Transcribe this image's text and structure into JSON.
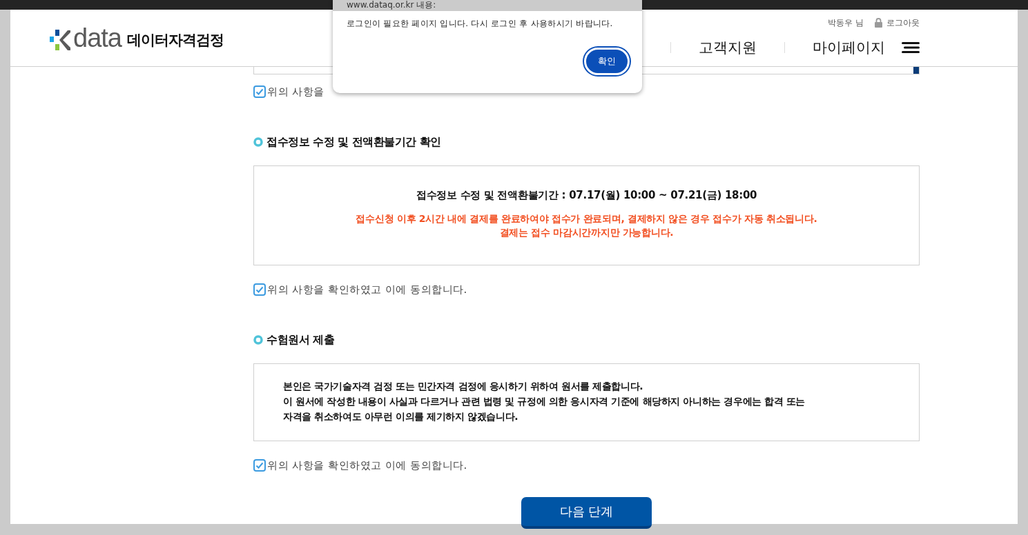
{
  "dialog": {
    "title": "www.dataq.or.kr 내용:",
    "message": "로그인이 필요한 페이지 입니다. 다시 로그인 후 사용하시기 바랍니다.",
    "button": "확인"
  },
  "header": {
    "logo_wordmark": "data",
    "logo_text": "데이터자격검정",
    "user": "박동우 님",
    "logout": "로그아웃",
    "nav": [
      "고객지원",
      "마이페이지"
    ]
  },
  "top_agreement": {
    "label": "위의 사항을",
    "checked": true
  },
  "sections": [
    {
      "kind": "notice",
      "title": "접수정보 수정 및 전액환불기간 확인",
      "heading": "접수정보 수정 및 전액환불기간 : 07.17(월) 10:00 ~ 07.21(금) 18:00",
      "lines": [
        "접수신청 이후 2시간 내에 결제를 완료하여야 접수가 완료되며, 결제하지 않은 경우 접수가 자동 취소됩니다.",
        "결제는 접수 마감시간까지만 가능합니다."
      ],
      "agreement": {
        "label": "위의 사항을 확인하였고 이에 동의합니다.",
        "checked": true
      }
    },
    {
      "kind": "pledge",
      "title": "수험원서 제출",
      "lines": [
        "본인은 국가기술자격 검정 또는 민간자격 검정에 응시하기 위하여 원서를 제출합니다.",
        "이 원서에 작성한 내용이 사실과 다르거나 관련 법령 및 규정에 의한 응시자격 기준에 해당하지 아니하는 경우에는 합격 또는",
        "자격을 취소하여도 아무런 이의를 제기하지 않겠습니다."
      ],
      "agreement": {
        "label": "위의 사항을 확인하였고 이에 동의합니다.",
        "checked": true
      }
    }
  ],
  "next_button": "다음 단계"
}
